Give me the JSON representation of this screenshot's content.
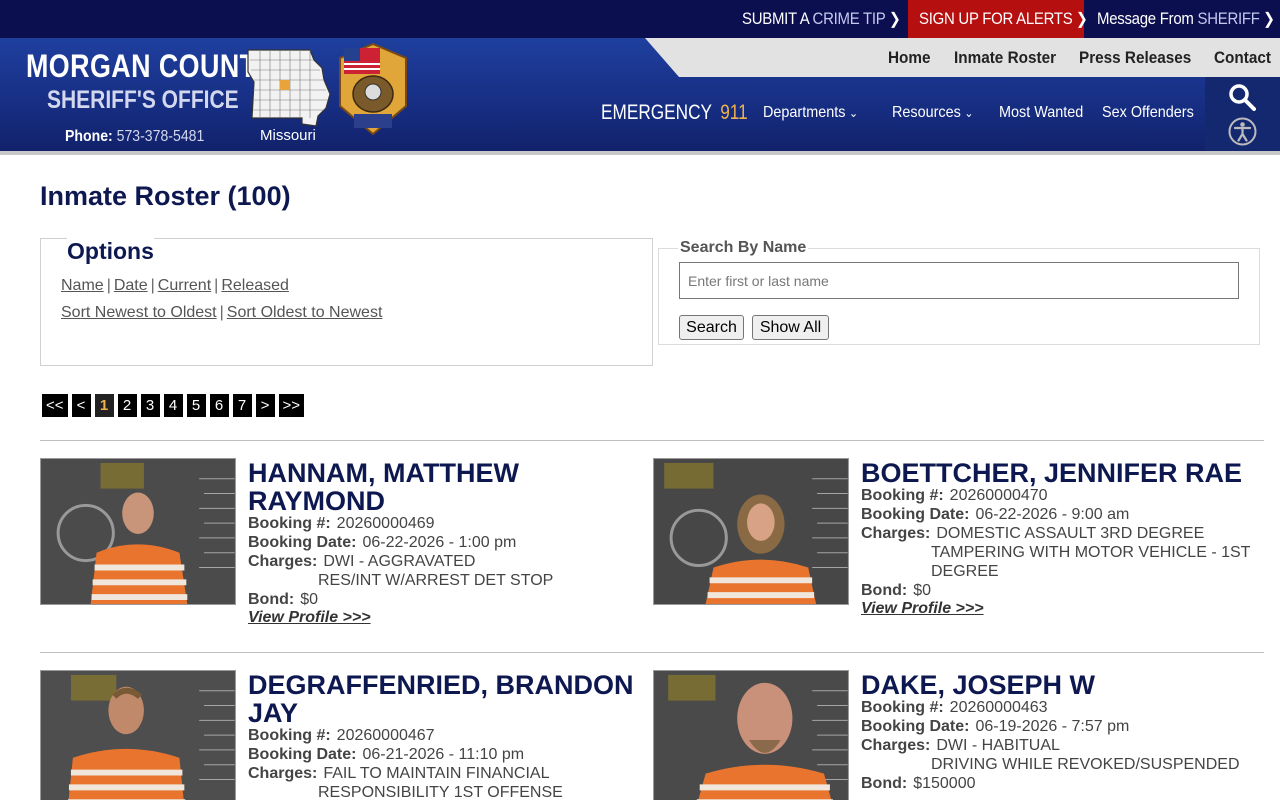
{
  "topbar": {
    "crime_tip_a": "SUBMIT A",
    "crime_tip_b": "CRIME TIP",
    "alerts": "SIGN UP FOR ALERTS",
    "message_a": "Message From",
    "message_b": "SHERIFF"
  },
  "brand": {
    "line1": "MORGAN COUNTY",
    "line2": "SHERIFF'S OFFICE",
    "phone_label": "Phone:",
    "phone_number": "573-378-5481",
    "map_label": "Missouri"
  },
  "nav_top": [
    "Home",
    "Inmate Roster",
    "Press Releases",
    "Contact"
  ],
  "emergency": {
    "label": "EMERGENCY",
    "number": "911"
  },
  "nav_sub": [
    "Departments",
    "Resources",
    "Most Wanted",
    "Sex Offenders"
  ],
  "page_title": "Inmate Roster (100)",
  "options": {
    "legend": "Options",
    "filters": [
      "Name",
      "Date",
      "Current",
      "Released"
    ],
    "sorts": [
      "Sort Newest to Oldest",
      "Sort Oldest to Newest"
    ]
  },
  "search": {
    "label": "Search By Name",
    "placeholder": "Enter first or last name",
    "search_button": "Search",
    "show_all_button": "Show All"
  },
  "pager": [
    "<<",
    "<",
    "1",
    "2",
    "3",
    "4",
    "5",
    "6",
    "7",
    ">",
    ">>"
  ],
  "pager_active": "1",
  "labels": {
    "booking": "Booking #:",
    "booking_date": "Booking Date:",
    "charges": "Charges:",
    "bond": "Bond:",
    "view_profile": "View Profile >>>"
  },
  "inmates": [
    {
      "name_1": "HANNAM, MATTHEW",
      "name_2": "RAYMOND",
      "booking": "20260000469",
      "booking_date": "06-22-2026 - 1:00 pm",
      "charges": [
        "DWI - AGGRAVATED",
        "RES/INT W/ARREST DET STOP"
      ],
      "bond": "$0"
    },
    {
      "name_1": "BOETTCHER, JENNIFER RAE",
      "booking": "20260000470",
      "booking_date": "06-22-2026 - 9:00 am",
      "charges": [
        "DOMESTIC ASSAULT 3RD DEGREE",
        "TAMPERING WITH MOTOR VEHICLE - 1ST",
        "DEGREE"
      ],
      "bond": "$0"
    },
    {
      "name_1": "DEGRAFFENRIED, BRANDON",
      "name_2": "JAY",
      "booking": "20260000467",
      "booking_date": "06-21-2026 - 11:10 pm",
      "charges": [
        "FAIL TO MAINTAIN FINANCIAL",
        "RESPONSIBILITY 1ST OFFENSE"
      ]
    },
    {
      "name_1": "DAKE, JOSEPH W",
      "booking": "20260000463",
      "booking_date": "06-19-2026 - 7:57 pm",
      "charges": [
        "DWI - HABITUAL",
        "DRIVING WHILE REVOKED/SUSPENDED"
      ],
      "bond": "$150000"
    }
  ],
  "colors": {
    "topbar": "#0c0f4f",
    "alert_red": "#b60f0f",
    "header_blue": "#1f3f9e",
    "title_navy": "#0e1850",
    "emergency_gold": "#f0b34a"
  },
  "icons": [
    "chevron-right-icon",
    "search-icon",
    "accessibility-icon",
    "missouri-map-icon",
    "sheriff-badge-icon",
    "caret-down-icon"
  ]
}
